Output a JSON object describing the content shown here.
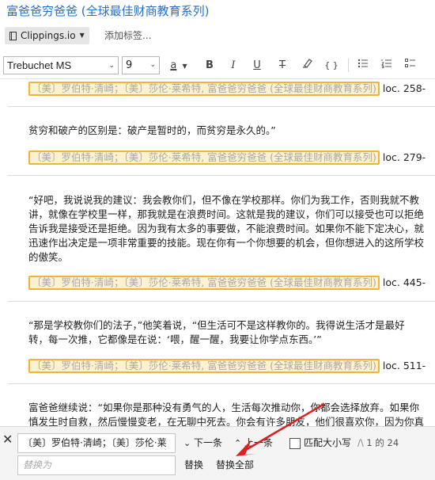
{
  "window": {
    "title": "富爸爸穷爸爸 (全球最佳财商教育系列)"
  },
  "notebook": {
    "label": "Clippings.io",
    "tag_placeholder": "添加标签..."
  },
  "toolbar": {
    "font_family": "Trebuchet MS",
    "font_size": "9",
    "text_color_glyph": "a",
    "bold": "B",
    "italic": "I",
    "underline": "U",
    "strike": "T",
    "code": "{ }"
  },
  "content": {
    "blocks": [
      {
        "text_lines": [],
        "citation": "〔美〕罗伯特·清崎；〔美〕莎伦·莱希特, 富爸爸穷爸爸 (全球最佳财商教育系列)",
        "loc": "loc. 258-"
      },
      {
        "text_lines": [
          "贫穷和破产的区别是：破产是暂时的，而贫穷是永久的。”"
        ],
        "citation": "〔美〕罗伯特·清崎；〔美〕莎伦·莱希特, 富爸爸穷爸爸 (全球最佳财商教育系列)",
        "loc": "loc. 279-"
      },
      {
        "text_lines": [
          "“好吧，我说说我的建议：我会教你们，但不像在学校那样。你们为我工作，否则我就不教",
          "讲，就像在学校里一样，那我就是在浪费时间。这就是我的建议，你们可以接受也可以拒绝",
          "告诉我是接受还是拒绝。因为我有太多的事要做，不能浪费时间。如果你不能下定决心，就",
          "迅速作出决定是一项非常重要的技能。现在你有一个你想要的机会，但你想进入的这所学校",
          "的傲笑。"
        ],
        "citation": "〔美〕罗伯特·清崎；〔美〕莎伦·莱希特, 富爸爸穷爸爸 (全球最佳财商教育系列)",
        "loc": "loc. 445-"
      },
      {
        "text_lines": [
          "“那是学校教你们的法子，”他笑着说，“但生活可不是这样教你的。我得说生活才是最好",
          "转，每一次推，它都像是在说：‘喂，醒一醒，我要让你学点东西。’”"
        ],
        "citation": "〔美〕罗伯特·清崎；〔美〕莎伦·莱希特, 富爸爸穷爸爸 (全球最佳财商教育系列)",
        "loc": "loc. 511-"
      },
      {
        "text_lines": [
          "富爸爸继续说：“如果你是那种没有勇气的人，生活每次推动你，你都会选择放弃。如果你",
          "慎发生时自救，然后慢慢变老，在无聊中死去。你会有许多朋友，他们很喜欢你，因为你真"
        ],
        "citation": "",
        "loc": ""
      }
    ]
  },
  "findbar": {
    "close_glyph": "✕",
    "find_value": "〔美〕罗伯特·清崎；〔美〕莎伦·莱",
    "next_label": "下一条",
    "prev_label": "上一条",
    "match_case_label": "匹配大小写",
    "counter": "1 的 24",
    "replace_placeholder": "替换为",
    "replace_label": "替换",
    "replace_all_label": "替换全部"
  },
  "colors": {
    "title": "#2a6fc4",
    "citation_fill": "#fdf2cf",
    "citation_border": "#f0b43a",
    "annotation_arrow": "#e02020"
  }
}
